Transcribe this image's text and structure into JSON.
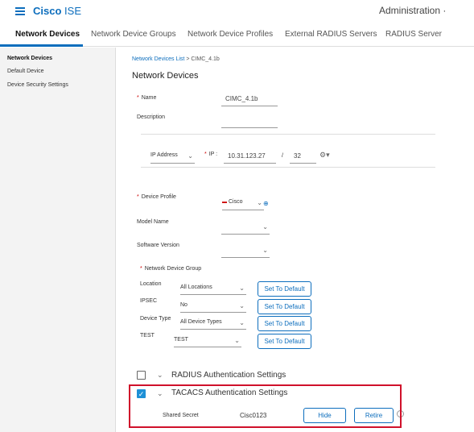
{
  "header": {
    "brand_bold": "Cisco",
    "brand_light": "ISE",
    "admin": "Administration ·"
  },
  "tabs": [
    {
      "label": "Network Devices"
    },
    {
      "label": "Network Device Groups"
    },
    {
      "label": "Network Device Profiles"
    },
    {
      "label": "External RADIUS Servers"
    },
    {
      "label": "RADIUS Server"
    }
  ],
  "sidebar": {
    "items": [
      {
        "label": "Network Devices"
      },
      {
        "label": "Default Device"
      },
      {
        "label": "Device Security Settings"
      }
    ]
  },
  "breadcrumb": {
    "link": "Network Devices List",
    "separator": ">",
    "current": "CIMC_4.1b"
  },
  "page": {
    "title": "Network Devices"
  },
  "form": {
    "name_label": "Name",
    "name_value": "CIMC_4.1b",
    "description_label": "Description",
    "description_value": "",
    "ip_type": "IP Address",
    "ip_label": "IP :",
    "ip_value": "10.31.123.27",
    "slash": "/",
    "mask_value": "32",
    "device_profile_label": "Device Profile",
    "device_profile_value": "Cisco",
    "model_name_label": "Model Name",
    "software_version_label": "Software Version",
    "ndg_label": "Network Device Group",
    "location_label": "Location",
    "location_value": "All Locations",
    "ipsec_label": "IPSEC",
    "ipsec_value": "No",
    "device_type_label": "Device Type",
    "device_type_value": "All Device Types",
    "test_label": "TEST",
    "test_value": "TEST",
    "set_default_label": "Set To Default"
  },
  "sections": {
    "radius": {
      "title": "RADIUS Authentication Settings",
      "checked": false
    },
    "tacacs": {
      "title": "TACACS Authentication Settings",
      "checked": true
    },
    "shared_secret_label": "Shared Secret",
    "shared_secret_value": "Cisc0123",
    "hide_label": "Hide",
    "retire_label": "Retire"
  },
  "colors": {
    "accent": "#0d6ebd",
    "highlight": "#d0112b",
    "checkbox": "#1e90d6"
  },
  "icons": [
    "hamburger-icon",
    "chevron-down-icon",
    "settings-icon",
    "info-icon",
    "add-icon",
    "cisco-logo-icon"
  ]
}
